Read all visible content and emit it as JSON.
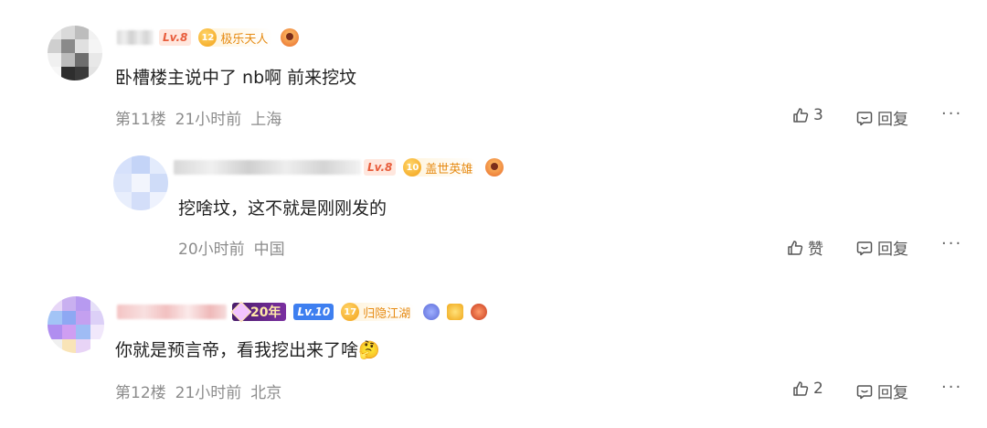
{
  "comments": [
    {
      "level": "Lv.8",
      "honor_num": "12",
      "honor_title": "极乐天人",
      "text": "卧槽楼主说中了 nb啊 前来挖坟",
      "floor": "第11楼",
      "time": "21小时前",
      "location": "上海",
      "like_label": "3",
      "reply_label": "回复",
      "more_label": "···"
    },
    {
      "level": "Lv.8",
      "honor_num": "10",
      "honor_title": "盖世英雄",
      "text": "挖啥坟，这不就是刚刚发的",
      "time": "20小时前",
      "location": "中国",
      "like_label": "赞",
      "reply_label": "回复",
      "more_label": "···"
    },
    {
      "years_badge": "20年",
      "level": "Lv.10",
      "honor_num": "17",
      "honor_title": "归隐江湖",
      "text": "你就是预言帝，看我挖出来了啥🤔",
      "floor": "第12楼",
      "time": "21小时前",
      "location": "北京",
      "like_label": "2",
      "reply_label": "回复",
      "more_label": "···"
    }
  ],
  "colors": {
    "meta": "#8c8c8c",
    "level_text": "#e85d3c",
    "honor_text": "#e68a12",
    "level_blue": "#3e7ff0"
  }
}
